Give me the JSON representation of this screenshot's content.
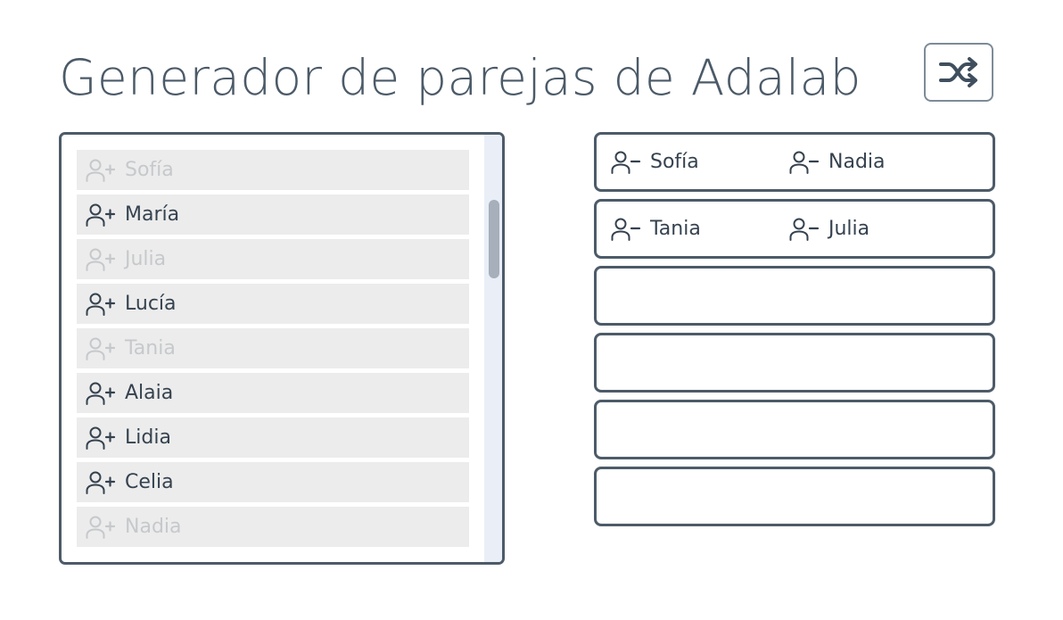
{
  "header": {
    "title": "Generador de parejas de Adalab",
    "shuffle_icon": "shuffle-icon"
  },
  "people_list": {
    "items": [
      {
        "name": "Sofía",
        "disabled": true,
        "icon": "user-plus-icon"
      },
      {
        "name": "María",
        "disabled": false,
        "icon": "user-plus-icon"
      },
      {
        "name": "Julia",
        "disabled": true,
        "icon": "user-plus-icon"
      },
      {
        "name": "Lucía",
        "disabled": false,
        "icon": "user-plus-icon"
      },
      {
        "name": "Tania",
        "disabled": true,
        "icon": "user-plus-icon"
      },
      {
        "name": "Alaia",
        "disabled": false,
        "icon": "user-plus-icon"
      },
      {
        "name": "Lidia",
        "disabled": false,
        "icon": "user-plus-icon"
      },
      {
        "name": "Celia",
        "disabled": false,
        "icon": "user-plus-icon"
      },
      {
        "name": "Nadia",
        "disabled": true,
        "icon": "user-plus-icon"
      }
    ]
  },
  "pairs": [
    {
      "members": [
        "Sofía",
        "Nadia"
      ]
    },
    {
      "members": [
        "Tania",
        "Julia"
      ]
    },
    {
      "members": []
    },
    {
      "members": []
    },
    {
      "members": []
    },
    {
      "members": []
    }
  ],
  "colors": {
    "text": "#35424f",
    "disabled_text": "#c6c9cc",
    "border": "#4d5b68",
    "item_bg": "#ececec"
  }
}
